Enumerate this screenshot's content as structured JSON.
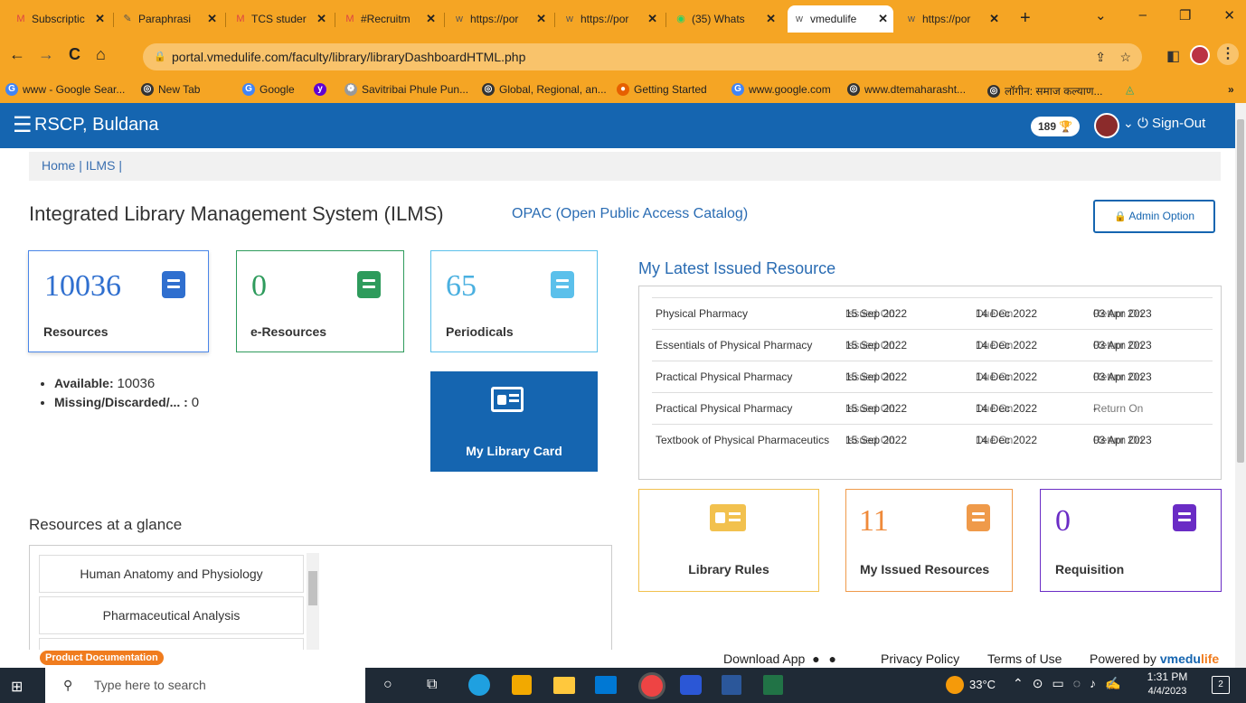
{
  "browser": {
    "tabs": [
      {
        "title": "Subscriptic",
        "icon": "gmail-icon",
        "ic": "M",
        "col": "#d44"
      },
      {
        "title": "Paraphrasi",
        "icon": "quill-icon",
        "ic": "✎",
        "col": "#555"
      },
      {
        "title": "TCS studer",
        "icon": "gmail-icon",
        "ic": "M",
        "col": "#d44"
      },
      {
        "title": "#Recruitm",
        "icon": "gmail-icon",
        "ic": "M",
        "col": "#d44"
      },
      {
        "title": "https://por",
        "icon": "vmedulife-icon",
        "ic": "ᴡ",
        "col": "#555"
      },
      {
        "title": "https://por",
        "icon": "vmedulife-icon",
        "ic": "ᴡ",
        "col": "#555"
      },
      {
        "title": "(35) Whats",
        "icon": "whatsapp-icon",
        "ic": "◉",
        "col": "#25d366"
      },
      {
        "title": "vmedulife",
        "icon": "vmedulife-icon",
        "ic": "ᴡ",
        "col": "#555"
      },
      {
        "title": "https://por",
        "icon": "vmedulife-icon",
        "ic": "ᴡ",
        "col": "#555"
      }
    ],
    "close_glyph": "✕",
    "new_tab": "+",
    "url": "portal.vmedulife.com/faculty/library/libraryDashboardHTML.php",
    "bookmarks": [
      {
        "label": "www - Google Sear...",
        "icon": "google-icon",
        "bg": "#4285f4",
        "ic": "G"
      },
      {
        "label": "New Tab",
        "icon": "globe-icon",
        "bg": "#333",
        "ic": "◎"
      },
      {
        "label": "Google",
        "icon": "google-icon",
        "bg": "#4285f4",
        "ic": "G"
      },
      {
        "label": "",
        "icon": "yahoo-icon",
        "bg": "#6001d2",
        "ic": "y"
      },
      {
        "label": "Savitribai Phule Pun...",
        "icon": "university-icon",
        "bg": "#999",
        "ic": "❁"
      },
      {
        "label": "Global, Regional, an...",
        "icon": "globe-icon",
        "bg": "#333",
        "ic": "◎"
      },
      {
        "label": "Getting Started",
        "icon": "firefox-icon",
        "bg": "#e66000",
        "ic": "●"
      },
      {
        "label": "www.google.com",
        "icon": "google-icon",
        "bg": "#4285f4",
        "ic": "G"
      },
      {
        "label": "www.dtemaharasht...",
        "icon": "globe-icon",
        "bg": "#333",
        "ic": "◎"
      },
      {
        "label": "लॉगीन: समाज कल्याण...",
        "icon": "globe-icon",
        "bg": "#333",
        "ic": "◎"
      }
    ],
    "more": "»"
  },
  "header": {
    "menu_glyph": "☰",
    "college": "RSCP, Buldana",
    "points": "189",
    "signout": "Sign-Out"
  },
  "breadcrumb": "Home | ILMS |",
  "page": {
    "title": "Integrated Library Management System (ILMS)",
    "opac": "OPAC (Open Public Access Catalog)",
    "admin": "Admin Option"
  },
  "cards": {
    "resources": {
      "num": "10036",
      "label": "Resources"
    },
    "eresources": {
      "num": "0",
      "label": "e-Resources"
    },
    "periodicals": {
      "num": "65",
      "label": "Periodicals"
    },
    "library_card": "My Library Card",
    "library_rules": "Library Rules",
    "my_issued": {
      "num": "11",
      "label": "My Issued Resources"
    },
    "requisition": {
      "num": "0",
      "label": "Requisition"
    }
  },
  "stats": {
    "available_label": "Available:",
    "available": "10036",
    "missing_label": "Missing/Discarded/... :",
    "missing": "0"
  },
  "issued": {
    "title": "My Latest Issued Resource",
    "issued_on": "Issued On",
    "due_on": "Due On",
    "return_on": "Return On",
    "rows": [
      {
        "name": "Physical Pharmacy",
        "issued": "15 Sep 2022",
        "due": "14 Dec 2022",
        "ret": "03 Apr 2023"
      },
      {
        "name": "Essentials of Physical Pharmacy",
        "issued": "15 Sep 2022",
        "due": "14 Dec 2022",
        "ret": "03 Apr 2023"
      },
      {
        "name": "Practical Physical Pharmacy",
        "issued": "15 Sep 2022",
        "due": "14 Dec 2022",
        "ret": "03 Apr 2023"
      },
      {
        "name": "Practical Physical Pharmacy",
        "issued": "15 Sep 2022",
        "due": "14 Dec 2022",
        "ret": "-"
      },
      {
        "name": "Textbook of Physical Pharmaceutics",
        "issued": "15 Sep 2022",
        "due": "14 Dec 2022",
        "ret": "03 Apr 2023"
      }
    ]
  },
  "glance": {
    "title": "Resources at a glance",
    "items": [
      "Human Anatomy and Physiology",
      "Pharmaceutical Analysis"
    ]
  },
  "footer": {
    "product_doc": "Product Documentation",
    "download": "Download App",
    "privacy": "Privacy Policy",
    "terms": "Terms of Use",
    "powered": "Powered by",
    "brand_pre": "vmedu",
    "brand_post": "life"
  },
  "taskbar": {
    "search": "Type here to search",
    "temp": "33°C",
    "time": "1:31 PM",
    "date": "4/4/2023",
    "notif": "2"
  }
}
